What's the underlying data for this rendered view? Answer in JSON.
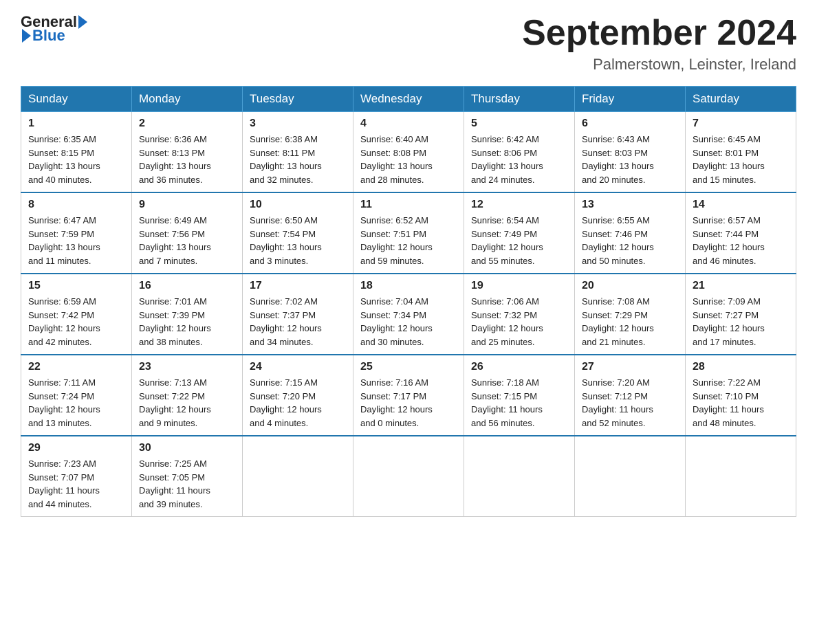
{
  "header": {
    "logo_text_general": "General",
    "logo_text_blue": "Blue",
    "month_title": "September 2024",
    "location": "Palmerstown, Leinster, Ireland"
  },
  "days_of_week": [
    "Sunday",
    "Monday",
    "Tuesday",
    "Wednesday",
    "Thursday",
    "Friday",
    "Saturday"
  ],
  "weeks": [
    [
      {
        "day": "1",
        "sunrise": "6:35 AM",
        "sunset": "8:15 PM",
        "daylight": "13 hours and 40 minutes."
      },
      {
        "day": "2",
        "sunrise": "6:36 AM",
        "sunset": "8:13 PM",
        "daylight": "13 hours and 36 minutes."
      },
      {
        "day": "3",
        "sunrise": "6:38 AM",
        "sunset": "8:11 PM",
        "daylight": "13 hours and 32 minutes."
      },
      {
        "day": "4",
        "sunrise": "6:40 AM",
        "sunset": "8:08 PM",
        "daylight": "13 hours and 28 minutes."
      },
      {
        "day": "5",
        "sunrise": "6:42 AM",
        "sunset": "8:06 PM",
        "daylight": "13 hours and 24 minutes."
      },
      {
        "day": "6",
        "sunrise": "6:43 AM",
        "sunset": "8:03 PM",
        "daylight": "13 hours and 20 minutes."
      },
      {
        "day": "7",
        "sunrise": "6:45 AM",
        "sunset": "8:01 PM",
        "daylight": "13 hours and 15 minutes."
      }
    ],
    [
      {
        "day": "8",
        "sunrise": "6:47 AM",
        "sunset": "7:59 PM",
        "daylight": "13 hours and 11 minutes."
      },
      {
        "day": "9",
        "sunrise": "6:49 AM",
        "sunset": "7:56 PM",
        "daylight": "13 hours and 7 minutes."
      },
      {
        "day": "10",
        "sunrise": "6:50 AM",
        "sunset": "7:54 PM",
        "daylight": "13 hours and 3 minutes."
      },
      {
        "day": "11",
        "sunrise": "6:52 AM",
        "sunset": "7:51 PM",
        "daylight": "12 hours and 59 minutes."
      },
      {
        "day": "12",
        "sunrise": "6:54 AM",
        "sunset": "7:49 PM",
        "daylight": "12 hours and 55 minutes."
      },
      {
        "day": "13",
        "sunrise": "6:55 AM",
        "sunset": "7:46 PM",
        "daylight": "12 hours and 50 minutes."
      },
      {
        "day": "14",
        "sunrise": "6:57 AM",
        "sunset": "7:44 PM",
        "daylight": "12 hours and 46 minutes."
      }
    ],
    [
      {
        "day": "15",
        "sunrise": "6:59 AM",
        "sunset": "7:42 PM",
        "daylight": "12 hours and 42 minutes."
      },
      {
        "day": "16",
        "sunrise": "7:01 AM",
        "sunset": "7:39 PM",
        "daylight": "12 hours and 38 minutes."
      },
      {
        "day": "17",
        "sunrise": "7:02 AM",
        "sunset": "7:37 PM",
        "daylight": "12 hours and 34 minutes."
      },
      {
        "day": "18",
        "sunrise": "7:04 AM",
        "sunset": "7:34 PM",
        "daylight": "12 hours and 30 minutes."
      },
      {
        "day": "19",
        "sunrise": "7:06 AM",
        "sunset": "7:32 PM",
        "daylight": "12 hours and 25 minutes."
      },
      {
        "day": "20",
        "sunrise": "7:08 AM",
        "sunset": "7:29 PM",
        "daylight": "12 hours and 21 minutes."
      },
      {
        "day": "21",
        "sunrise": "7:09 AM",
        "sunset": "7:27 PM",
        "daylight": "12 hours and 17 minutes."
      }
    ],
    [
      {
        "day": "22",
        "sunrise": "7:11 AM",
        "sunset": "7:24 PM",
        "daylight": "12 hours and 13 minutes."
      },
      {
        "day": "23",
        "sunrise": "7:13 AM",
        "sunset": "7:22 PM",
        "daylight": "12 hours and 9 minutes."
      },
      {
        "day": "24",
        "sunrise": "7:15 AM",
        "sunset": "7:20 PM",
        "daylight": "12 hours and 4 minutes."
      },
      {
        "day": "25",
        "sunrise": "7:16 AM",
        "sunset": "7:17 PM",
        "daylight": "12 hours and 0 minutes."
      },
      {
        "day": "26",
        "sunrise": "7:18 AM",
        "sunset": "7:15 PM",
        "daylight": "11 hours and 56 minutes."
      },
      {
        "day": "27",
        "sunrise": "7:20 AM",
        "sunset": "7:12 PM",
        "daylight": "11 hours and 52 minutes."
      },
      {
        "day": "28",
        "sunrise": "7:22 AM",
        "sunset": "7:10 PM",
        "daylight": "11 hours and 48 minutes."
      }
    ],
    [
      {
        "day": "29",
        "sunrise": "7:23 AM",
        "sunset": "7:07 PM",
        "daylight": "11 hours and 44 minutes."
      },
      {
        "day": "30",
        "sunrise": "7:25 AM",
        "sunset": "7:05 PM",
        "daylight": "11 hours and 39 minutes."
      },
      null,
      null,
      null,
      null,
      null
    ]
  ],
  "labels": {
    "sunrise": "Sunrise:",
    "sunset": "Sunset:",
    "daylight": "Daylight:"
  }
}
